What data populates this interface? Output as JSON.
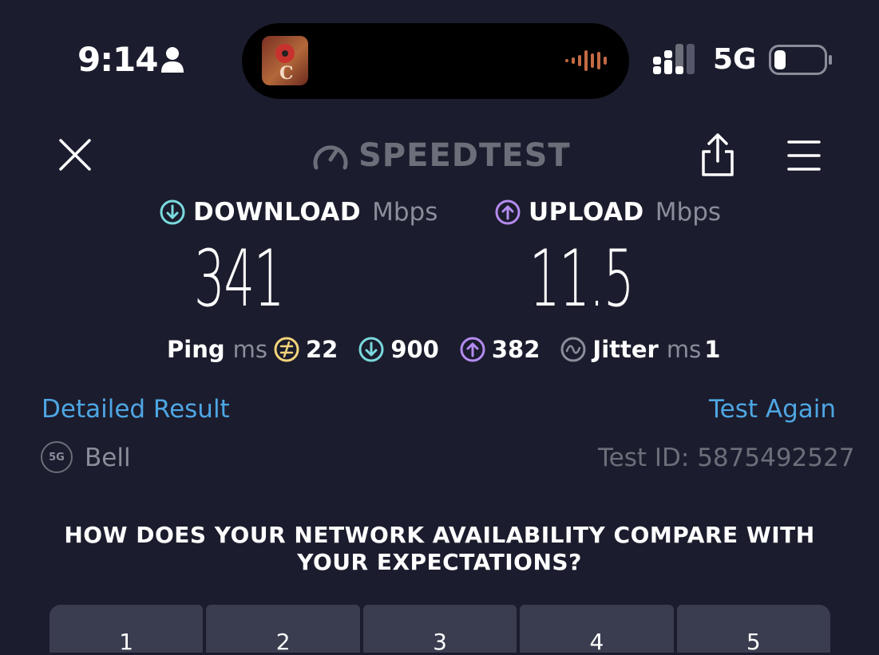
{
  "status_bar": {
    "time": "9:14",
    "network": "5G",
    "icons": [
      "person-icon",
      "audio-wave-icon",
      "signal-icon",
      "battery-icon"
    ]
  },
  "header": {
    "logo_text": "SPEEDTEST",
    "logo_tm": "®",
    "icons": [
      "close-icon",
      "speedometer-icon",
      "share-icon",
      "menu-icon"
    ]
  },
  "download": {
    "label": "DOWNLOAD",
    "unit": "Mbps",
    "value": "341",
    "color": "#7ad9dd"
  },
  "upload": {
    "label": "UPLOAD",
    "unit": "Mbps",
    "value": "11.5",
    "color": "#b48cf0"
  },
  "stats": {
    "ping_label": "Ping",
    "ping_unit": "ms",
    "idle_ping": "22",
    "download_ping": "900",
    "upload_ping": "382",
    "jitter_label": "Jitter",
    "jitter_unit": "ms",
    "jitter": "1",
    "idle_color": "#f3d47a"
  },
  "links": {
    "detailed": "Detailed Result",
    "again": "Test Again"
  },
  "provider": {
    "badge": "5G",
    "name": "Bell"
  },
  "test_id": "Test ID: 5875492527",
  "question": "HOW DOES YOUR NETWORK AVAILABILITY COMPARE WITH YOUR EXPECTATIONS?",
  "rating": [
    "1",
    "2",
    "3",
    "4",
    "5"
  ]
}
